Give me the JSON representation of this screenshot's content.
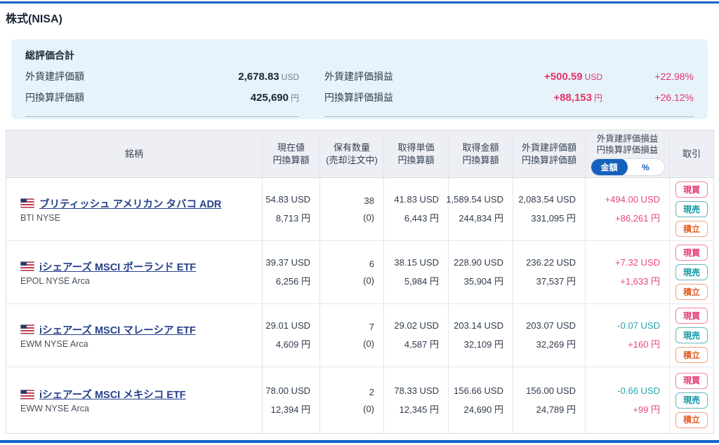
{
  "page": {
    "title": "株式(NISA)"
  },
  "colors": {
    "accent_blue": "#1563c8",
    "gain_pink": "#e6336b",
    "loss_teal": "#29a3ae",
    "summary_bg": "#e7f3fa",
    "header_bg": "#edeff5"
  },
  "summary": {
    "title": "総評価合計",
    "left_rows": [
      {
        "label": "外貨建評価額",
        "value": "2,678.83",
        "unit": "USD"
      },
      {
        "label": "円換算評価額",
        "value": "425,690",
        "unit": "円"
      }
    ],
    "right_rows": [
      {
        "label": "外貨建評価損益",
        "value": "+500.59",
        "unit": "USD",
        "pct": "+22.98%"
      },
      {
        "label": "円換算評価損益",
        "value": "+88,153",
        "unit": "円",
        "pct": "+26.12%"
      }
    ]
  },
  "table": {
    "columns": {
      "name": "銘柄",
      "price1": "現在値",
      "price2": "円換算額",
      "qty1": "保有数量",
      "qty2": "(売却注文中)",
      "cost1": "取得単価",
      "cost2": "円換算額",
      "amt1": "取得金額",
      "amt2": "円換算額",
      "val1": "外貨建評価額",
      "val2": "円換算評価額",
      "pl1": "外貨建評価損益",
      "pl2": "円換算評価損益",
      "trade": "取引"
    },
    "pl_toggle": {
      "amount": "金額",
      "percent": "%"
    },
    "buttons": {
      "buy": "現買",
      "sell": "現売",
      "acc": "積立"
    },
    "rows": [
      {
        "name": "ブリティッシュ アメリカン タバコ ADR",
        "ticker": "BTI NYSE",
        "price_usd": "54.83 USD",
        "price_jpy": "8,713 円",
        "qty": "38",
        "qty_order": "(0)",
        "cost_usd": "41.83 USD",
        "cost_jpy": "6,443 円",
        "amt_usd": "1,589.54 USD",
        "amt_jpy": "244,834 円",
        "val_usd": "2,083.54 USD",
        "val_jpy": "331,095 円",
        "pl_usd": "+494.00 USD",
        "pl_usd_sign": "gain",
        "pl_jpy": "+86,261 円",
        "pl_jpy_sign": "gain"
      },
      {
        "name": "iシェアーズ MSCI ポーランド ETF",
        "ticker": "EPOL NYSE Arca",
        "price_usd": "39.37 USD",
        "price_jpy": "6,256 円",
        "qty": "6",
        "qty_order": "(0)",
        "cost_usd": "38.15 USD",
        "cost_jpy": "5,984 円",
        "amt_usd": "228.90 USD",
        "amt_jpy": "35,904 円",
        "val_usd": "236.22 USD",
        "val_jpy": "37,537 円",
        "pl_usd": "+7.32 USD",
        "pl_usd_sign": "gain",
        "pl_jpy": "+1,633 円",
        "pl_jpy_sign": "gain"
      },
      {
        "name": "iシェアーズ MSCI マレーシア ETF",
        "ticker": "EWM NYSE Arca",
        "price_usd": "29.01 USD",
        "price_jpy": "4,609 円",
        "qty": "7",
        "qty_order": "(0)",
        "cost_usd": "29.02 USD",
        "cost_jpy": "4,587 円",
        "amt_usd": "203.14 USD",
        "amt_jpy": "32,109 円",
        "val_usd": "203.07 USD",
        "val_jpy": "32,269 円",
        "pl_usd": "-0.07 USD",
        "pl_usd_sign": "loss",
        "pl_jpy": "+160 円",
        "pl_jpy_sign": "gain"
      },
      {
        "name": "iシェアーズ MSCI メキシコ ETF",
        "ticker": "EWW NYSE Arca",
        "price_usd": "78.00 USD",
        "price_jpy": "12,394 円",
        "qty": "2",
        "qty_order": "(0)",
        "cost_usd": "78.33 USD",
        "cost_jpy": "12,345 円",
        "amt_usd": "156.66 USD",
        "amt_jpy": "24,690 円",
        "val_usd": "156.00 USD",
        "val_jpy": "24,789 円",
        "pl_usd": "-0.66 USD",
        "pl_usd_sign": "loss",
        "pl_jpy": "+99 円",
        "pl_jpy_sign": "gain"
      }
    ]
  }
}
